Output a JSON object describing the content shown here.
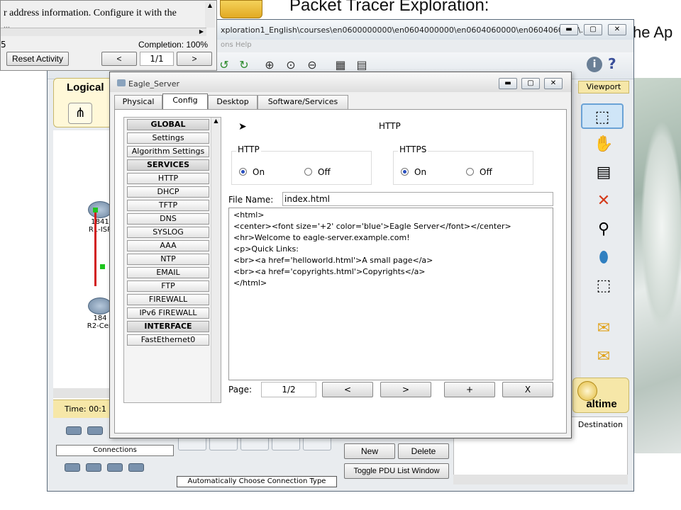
{
  "slide": {
    "title": "Packet Tracer Exploration:",
    "right_text": "he Ap"
  },
  "instructions": {
    "text_line1": "r address information. Configure it with the",
    "text_line2": "...",
    "left_number": "5",
    "completion": "Completion: 100%",
    "reset_button": "Reset Activity",
    "prev_button": "<",
    "page": "1/1",
    "next_button": ">"
  },
  "pt_window": {
    "title": "xploration1_English\\courses\\en0600000000\\en0604000000\\en0604060000\\en0604060100\\...",
    "menu_text": "ons    Help",
    "logical_tab": "Logical",
    "viewport_tab": "Viewport",
    "time_label": "Time: 00:1",
    "connections_label": "Connections",
    "connection_status": "Automatically Choose Connection Type",
    "pdu_new": "New",
    "pdu_delete": "Delete",
    "pdu_toggle": "Toggle PDU List Window",
    "destination_header": "Destination",
    "realtime_label": "altime",
    "devices": [
      {
        "model": "1841",
        "name": "R1-ISP"
      },
      {
        "model": "184",
        "name": "R2-Cen"
      }
    ]
  },
  "dialog": {
    "title": "Eagle_Server",
    "tabs": [
      "Physical",
      "Config",
      "Desktop",
      "Software/Services"
    ],
    "active_tab": "Config",
    "services": [
      {
        "label": "GLOBAL",
        "header": true
      },
      {
        "label": "Settings",
        "header": false
      },
      {
        "label": "Algorithm Settings",
        "header": false
      },
      {
        "label": "SERVICES",
        "header": true
      },
      {
        "label": "HTTP",
        "header": false
      },
      {
        "label": "DHCP",
        "header": false
      },
      {
        "label": "TFTP",
        "header": false
      },
      {
        "label": "DNS",
        "header": false
      },
      {
        "label": "SYSLOG",
        "header": false
      },
      {
        "label": "AAA",
        "header": false
      },
      {
        "label": "NTP",
        "header": false
      },
      {
        "label": "EMAIL",
        "header": false
      },
      {
        "label": "FTP",
        "header": false
      },
      {
        "label": "FIREWALL",
        "header": false
      },
      {
        "label": "IPv6 FIREWALL",
        "header": false
      },
      {
        "label": "INTERFACE",
        "header": true
      },
      {
        "label": "FastEthernet0",
        "header": false
      }
    ],
    "http_heading": "HTTP",
    "http_group": {
      "caption": "HTTP",
      "on": "On",
      "off": "Off",
      "selected": "On"
    },
    "https_group": {
      "caption": "HTTPS",
      "on": "On",
      "off": "Off",
      "selected": "On"
    },
    "file_name_label": "File Name:",
    "file_name_value": "index.html",
    "file_content": "<html>\n<center><font size='+2' color='blue'>Eagle Server</font></center>\n<hr>Welcome to eagle-server.example.com!\n<p>Quick Links:\n<br><a href='helloworld.html'>A small page</a>\n<br><a href='copyrights.html'>Copyrights</a>\n</html>",
    "page_label": "Page:",
    "page_value": "1/2",
    "prev_button": "<",
    "next_button": ">",
    "add_button": "+",
    "remove_button": "X"
  }
}
